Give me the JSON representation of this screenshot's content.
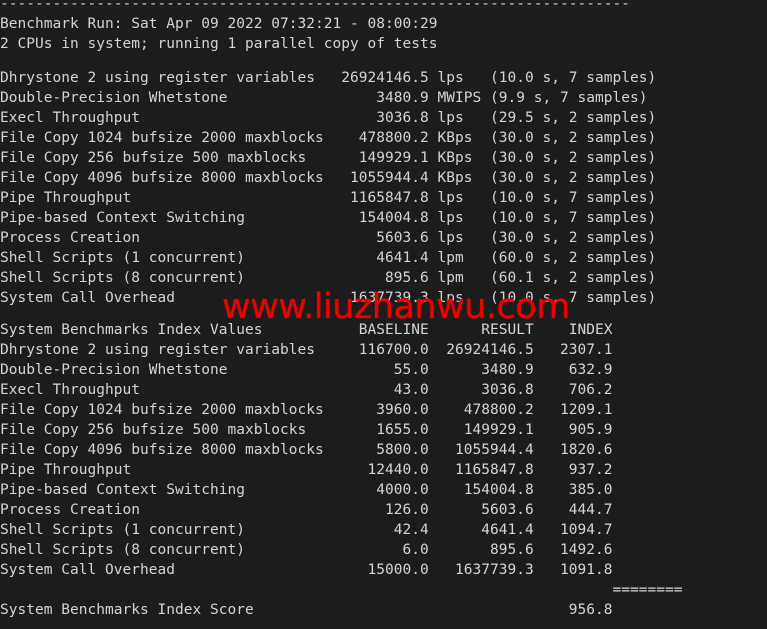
{
  "terminal": {
    "background_color": "#1c1c1c",
    "text_color": "#d4d4d4",
    "watermark_color": "#ee0000",
    "char_width": 8.45,
    "line_height": 20,
    "top_rule": "------------------------------------------------------------------------",
    "header": {
      "run_line": "Benchmark Run: Sat Apr 09 2022 07:32:21 - 08:00:29",
      "cpu_line": "2 CPUs in system; running 1 parallel copy of tests"
    },
    "watermark": "www.liuzhanwu.com",
    "results_section": {
      "rows": [
        {
          "name": "Dhrystone 2 using register variables",
          "value": "26924146.5",
          "unit": "lps",
          "detail": "(10.0 s, 7 samples)"
        },
        {
          "name": "Double-Precision Whetstone",
          "value": "3480.9",
          "unit": "MWIPS",
          "detail": "(9.9 s, 7 samples)"
        },
        {
          "name": "Execl Throughput",
          "value": "3036.8",
          "unit": "lps",
          "detail": "(29.5 s, 2 samples)"
        },
        {
          "name": "File Copy 1024 bufsize 2000 maxblocks",
          "value": "478800.2",
          "unit": "KBps",
          "detail": "(30.0 s, 2 samples)"
        },
        {
          "name": "File Copy 256 bufsize 500 maxblocks",
          "value": "149929.1",
          "unit": "KBps",
          "detail": "(30.0 s, 2 samples)"
        },
        {
          "name": "File Copy 4096 bufsize 8000 maxblocks",
          "value": "1055944.4",
          "unit": "KBps",
          "detail": "(30.0 s, 2 samples)"
        },
        {
          "name": "Pipe Throughput",
          "value": "1165847.8",
          "unit": "lps",
          "detail": "(10.0 s, 7 samples)"
        },
        {
          "name": "Pipe-based Context Switching",
          "value": "154004.8",
          "unit": "lps",
          "detail": "(10.0 s, 7 samples)"
        },
        {
          "name": "Process Creation",
          "value": "5603.6",
          "unit": "lps",
          "detail": "(30.0 s, 2 samples)"
        },
        {
          "name": "Shell Scripts (1 concurrent)",
          "value": "4641.4",
          "unit": "lpm",
          "detail": "(60.0 s, 2 samples)"
        },
        {
          "name": "Shell Scripts (8 concurrent)",
          "value": "895.6",
          "unit": "lpm",
          "detail": "(60.1 s, 2 samples)"
        },
        {
          "name": "System Call Overhead",
          "value": "1637739.3",
          "unit": "lps",
          "detail": "(10.0 s, 7 samples)"
        }
      ]
    },
    "index_section": {
      "title": "System Benchmarks Index Values",
      "columns": [
        "BASELINE",
        "RESULT",
        "INDEX"
      ],
      "rows": [
        {
          "name": "Dhrystone 2 using register variables",
          "baseline": "116700.0",
          "result": "26924146.5",
          "index": "2307.1"
        },
        {
          "name": "Double-Precision Whetstone",
          "baseline": "55.0",
          "result": "3480.9",
          "index": "632.9"
        },
        {
          "name": "Execl Throughput",
          "baseline": "43.0",
          "result": "3036.8",
          "index": "706.2"
        },
        {
          "name": "File Copy 1024 bufsize 2000 maxblocks",
          "baseline": "3960.0",
          "result": "478800.2",
          "index": "1209.1"
        },
        {
          "name": "File Copy 256 bufsize 500 maxblocks",
          "baseline": "1655.0",
          "result": "149929.1",
          "index": "905.9"
        },
        {
          "name": "File Copy 4096 bufsize 8000 maxblocks",
          "baseline": "5800.0",
          "result": "1055944.4",
          "index": "1820.6"
        },
        {
          "name": "Pipe Throughput",
          "baseline": "12440.0",
          "result": "1165847.8",
          "index": "937.2"
        },
        {
          "name": "Pipe-based Context Switching",
          "baseline": "4000.0",
          "result": "154004.8",
          "index": "385.0"
        },
        {
          "name": "Process Creation",
          "baseline": "126.0",
          "result": "5603.6",
          "index": "444.7"
        },
        {
          "name": "Shell Scripts (1 concurrent)",
          "baseline": "42.4",
          "result": "4641.4",
          "index": "1094.7"
        },
        {
          "name": "Shell Scripts (8 concurrent)",
          "baseline": "6.0",
          "result": "895.6",
          "index": "1492.6"
        },
        {
          "name": "System Call Overhead",
          "baseline": "15000.0",
          "result": "1637739.3",
          "index": "1091.8"
        }
      ],
      "separator": "========",
      "score_label": "System Benchmarks Index Score",
      "score_value": "956.8"
    }
  }
}
